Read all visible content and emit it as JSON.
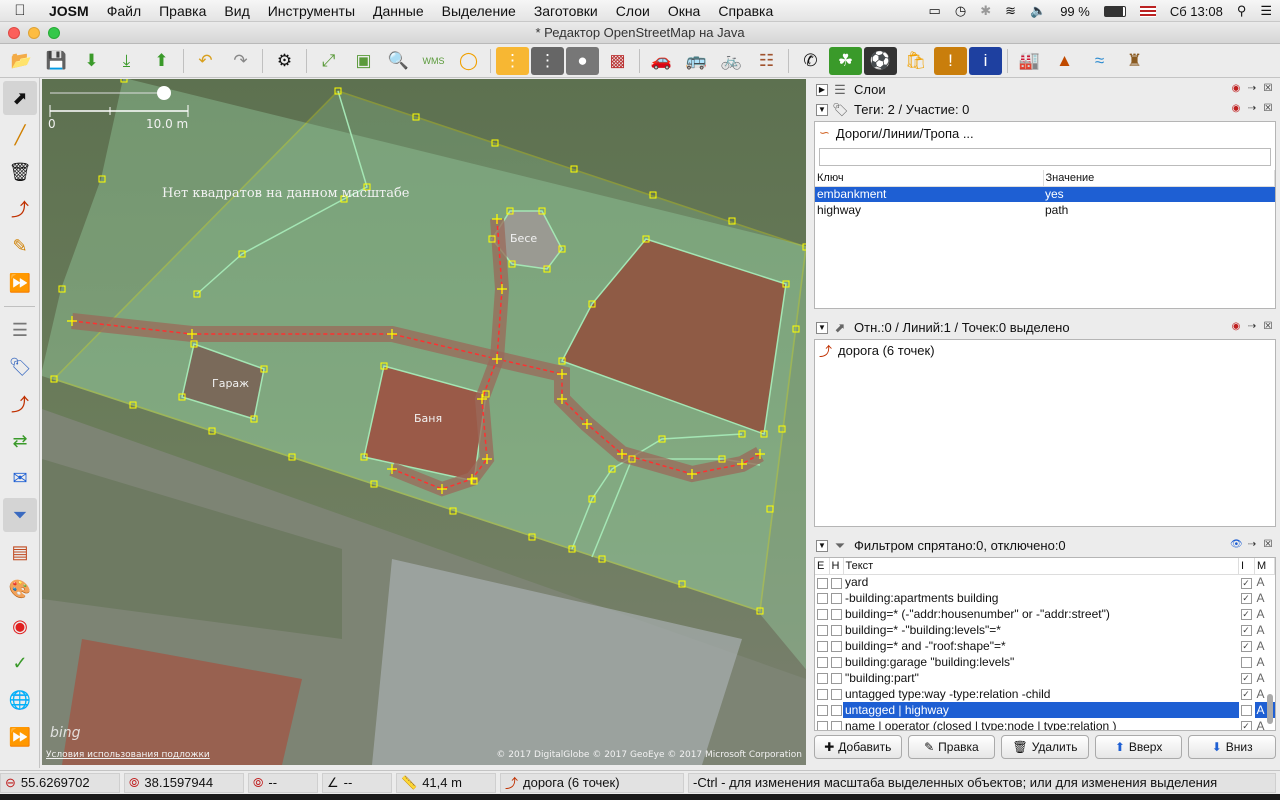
{
  "menubar": {
    "app_name": "JOSM",
    "items": [
      "Файл",
      "Правка",
      "Вид",
      "Инструменты",
      "Данные",
      "Выделение",
      "Заготовки",
      "Слои",
      "Окна",
      "Справка"
    ],
    "battery": "99 %",
    "clock": "Сб 13:08"
  },
  "window": {
    "title": "* Редактор OpenStreetMap на Java"
  },
  "map": {
    "scale_start": "0",
    "scale_end": "10.0 m",
    "no_tiles_message": "Нет квадратов на данном масштабе",
    "labels": {
      "garage": "Гараж",
      "bath": "Баня",
      "gazebo": "Бесе"
    },
    "bing_logo": "bing",
    "terms_link": "Условия использования подложки",
    "attribution": "© 2017 DigitalGlobe © 2017 GeoEye © 2017 Microsoft Corporation"
  },
  "layers_panel": {
    "title": "Слои"
  },
  "tags_panel": {
    "title": "Теги: 2 / Участие: 0",
    "preset_label": "Дороги/Линии/Тропа ...",
    "col_key": "Ключ",
    "col_value": "Значение",
    "rows": [
      {
        "key": "embankment",
        "value": "yes"
      },
      {
        "key": "highway",
        "value": "path"
      }
    ]
  },
  "selection_panel": {
    "title": "Отн.:0 / Линий:1 / Точек:0 выделено",
    "items": [
      "дорога (6 точек)"
    ]
  },
  "filter_panel": {
    "title": "Фильтром спрятано:0, отключено:0",
    "col_e": "E",
    "col_h": "H",
    "col_text": "Текст",
    "col_i": "I",
    "col_m": "M",
    "rows": [
      {
        "text": "yard",
        "mode": "A",
        "inverted": true
      },
      {
        "text": "-building:apartments building",
        "mode": "A",
        "inverted": true
      },
      {
        "text": "building=* (-\"addr:housenumber\" or -\"addr:street\")",
        "mode": "A",
        "inverted": true
      },
      {
        "text": "building=* -\"building:levels\"=*",
        "mode": "A",
        "inverted": true
      },
      {
        "text": "building=* and -\"roof:shape\"=*",
        "mode": "A",
        "inverted": true
      },
      {
        "text": "building:garage \"building:levels\"",
        "mode": "A",
        "inverted": false
      },
      {
        "text": "\"building:part\"",
        "mode": "A",
        "inverted": true
      },
      {
        "text": "untagged type:way -type:relation  -child",
        "mode": "A",
        "inverted": true
      },
      {
        "text": "untagged | highway",
        "mode": "A",
        "inverted": false
      },
      {
        "text": "name | operator (closed |  type:node |  type:relation )",
        "mode": "A",
        "inverted": true
      }
    ],
    "buttons": {
      "add": "Добавить",
      "edit": "Правка",
      "delete": "Удалить",
      "up": "Вверх",
      "down": "Вниз"
    }
  },
  "statusbar": {
    "lat": "55.6269702",
    "lon": "38.1597944",
    "heading": "--",
    "angle": "--",
    "distance": "41,4 m",
    "selection": "дорога (6 точек)",
    "help": "-Ctrl - для изменения масштаба выделенных объектов; или для изменения выделения"
  },
  "colors": {
    "selection_blue": "#1e5fd3",
    "way_yellow": "#ffff00",
    "area_green": "#a4e6b4",
    "road_red": "#ff3030"
  }
}
